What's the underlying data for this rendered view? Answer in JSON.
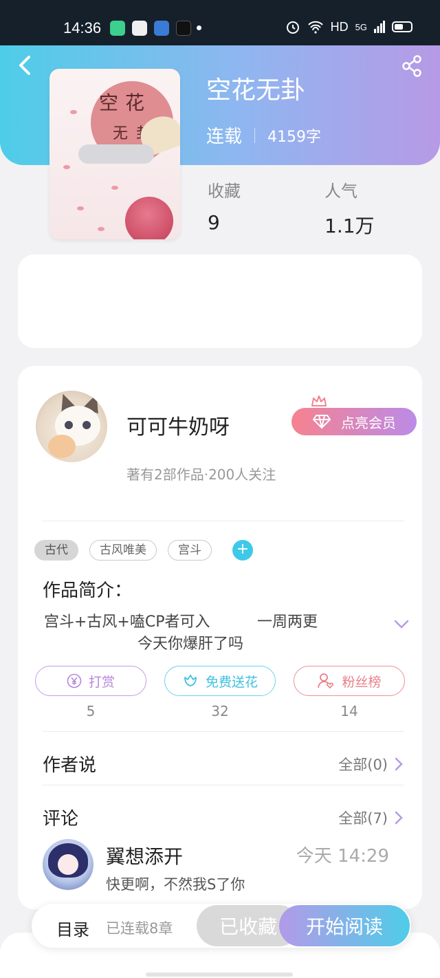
{
  "status_bar": {
    "time": "14:36",
    "network": "HD",
    "signal": "5G",
    "app_icons": [
      "green-app-icon",
      "photo-app-icon",
      "video-app-icon",
      "tiktok-icon"
    ]
  },
  "book": {
    "title": "空花无卦",
    "status": "连载",
    "word_count": "4159字",
    "cover_text_line1": "空花",
    "cover_text_line2": "无卦",
    "stats": [
      {
        "label": "收藏",
        "value": "9"
      },
      {
        "label": "人气",
        "value": "1.1万"
      }
    ]
  },
  "author": {
    "name": "可可牛奶呀",
    "meta": "著有2部作品·200人关注",
    "vip_button": "点亮会员"
  },
  "tags": [
    "古代",
    "古风唯美",
    "宫斗"
  ],
  "intro": {
    "heading": "作品简介：",
    "line1": "宫斗+古风+嗑CP者可入",
    "line1_right": "一周两更",
    "line2": "今天你爆肝了吗"
  },
  "actions": [
    {
      "label": "打赏",
      "count": "5"
    },
    {
      "label": "免费送花",
      "count": "32"
    },
    {
      "label": "粉丝榜",
      "count": "14"
    }
  ],
  "author_says": {
    "heading": "作者说",
    "all": "全部(0)"
  },
  "comments": {
    "heading": "评论",
    "all": "全部(7)",
    "items": [
      {
        "user": "翼想添开",
        "time": "今天 14:29",
        "text": "快更啊，不然我S了你"
      }
    ]
  },
  "bottom_bar": {
    "toc": "目录",
    "chapters": "已连载8章",
    "favorited": "已收藏",
    "read": "开始阅读"
  },
  "colors": {
    "hero_start": "#4ecde8",
    "hero_end": "#b79ae6",
    "cyan_accent": "#3fc9e8",
    "tip_purple": "#b486dc",
    "flower_cyan": "#3fc1e0",
    "fans_red": "#ea7f89"
  }
}
